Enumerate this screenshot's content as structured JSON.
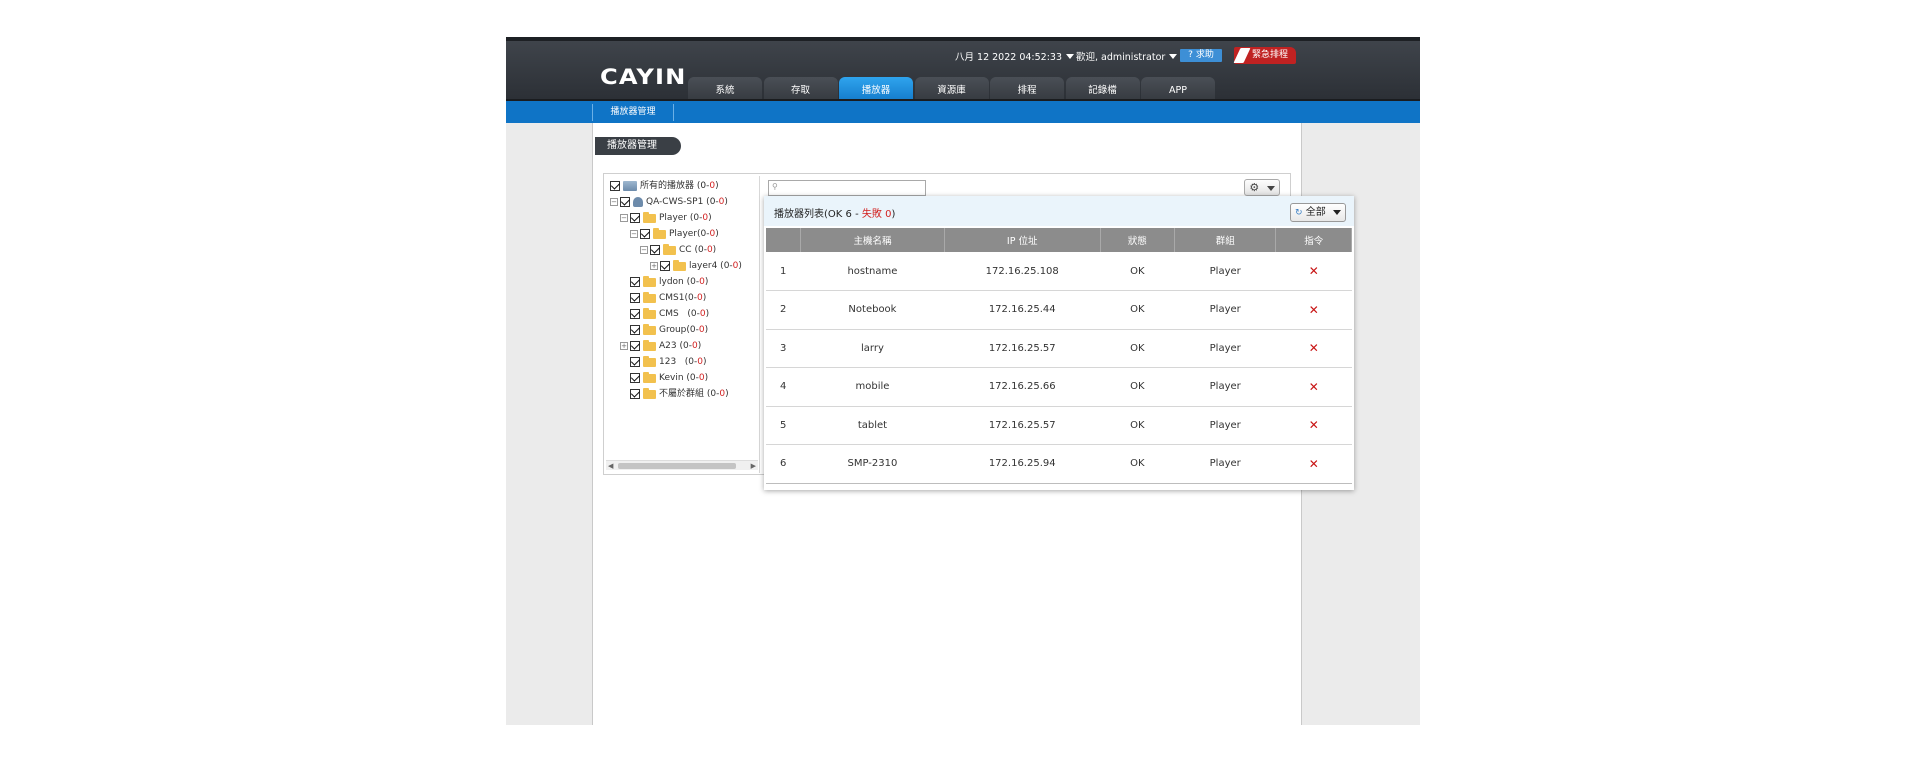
{
  "header": {
    "logo": "CAYIN",
    "datetime": "八月 12 2022 04:52:33",
    "welcome": "歡迎, administrator",
    "help": "求助",
    "emergency": "緊急排程"
  },
  "tabs": [
    {
      "label": "系統"
    },
    {
      "label": "存取"
    },
    {
      "label": "播放器"
    },
    {
      "label": "資源庫"
    },
    {
      "label": "排程"
    },
    {
      "label": "記錄檔"
    },
    {
      "label": "APP"
    }
  ],
  "subnav": {
    "item": "播放器管理"
  },
  "section_title": "播放器管理",
  "tree": {
    "root": {
      "label": "所有的播放器",
      "ok": "0",
      "fail": "0"
    },
    "server": {
      "label": "QA-CWS-SP1",
      "ok": "0",
      "fail": "0"
    },
    "nodes": [
      {
        "label": "Player",
        "ok": "0",
        "fail": "0"
      },
      {
        "label": "Player",
        "ok": "0",
        "fail": "0"
      },
      {
        "label": "CC",
        "ok": "0",
        "fail": "0"
      },
      {
        "label": "layer4",
        "ok": "0",
        "fail": "0"
      },
      {
        "label": "lydon",
        "ok": "0",
        "fail": "0"
      },
      {
        "label": "CMS1",
        "ok": "0",
        "fail": "0"
      },
      {
        "label": "CMS",
        "ok": "0",
        "fail": "0"
      },
      {
        "label": "Group",
        "ok": "0",
        "fail": "0"
      },
      {
        "label": "A23",
        "ok": "0",
        "fail": "0"
      },
      {
        "label": "123",
        "ok": "0",
        "fail": "0"
      },
      {
        "label": "Kevin",
        "ok": "0",
        "fail": "0"
      },
      {
        "label": "不屬於群組",
        "ok": "0",
        "fail": "0"
      }
    ]
  },
  "list": {
    "title_prefix": "播放器列表(OK",
    "ok_count": "6",
    "fail_label": "失敗",
    "fail_count": "0",
    "filter": "全部",
    "columns": [
      "",
      "主機名稱",
      "IP 位址",
      "狀態",
      "群組",
      "指令"
    ],
    "rows": [
      {
        "idx": "1",
        "host": "hostname",
        "ip": "172.16.25.108",
        "status": "OK",
        "group": "Player"
      },
      {
        "idx": "2",
        "host": "Notebook",
        "ip": "172.16.25.44",
        "status": "OK",
        "group": "Player"
      },
      {
        "idx": "3",
        "host": "larry",
        "ip": "172.16.25.57",
        "status": "OK",
        "group": "Player"
      },
      {
        "idx": "4",
        "host": "mobile",
        "ip": "172.16.25.66",
        "status": "OK",
        "group": "Player"
      },
      {
        "idx": "5",
        "host": "tablet",
        "ip": "172.16.25.57",
        "status": "OK",
        "group": "Player"
      },
      {
        "idx": "6",
        "host": "SMP-2310",
        "ip": "172.16.25.94",
        "status": "OK",
        "group": "Player"
      }
    ],
    "delete_symbol": "✕"
  }
}
